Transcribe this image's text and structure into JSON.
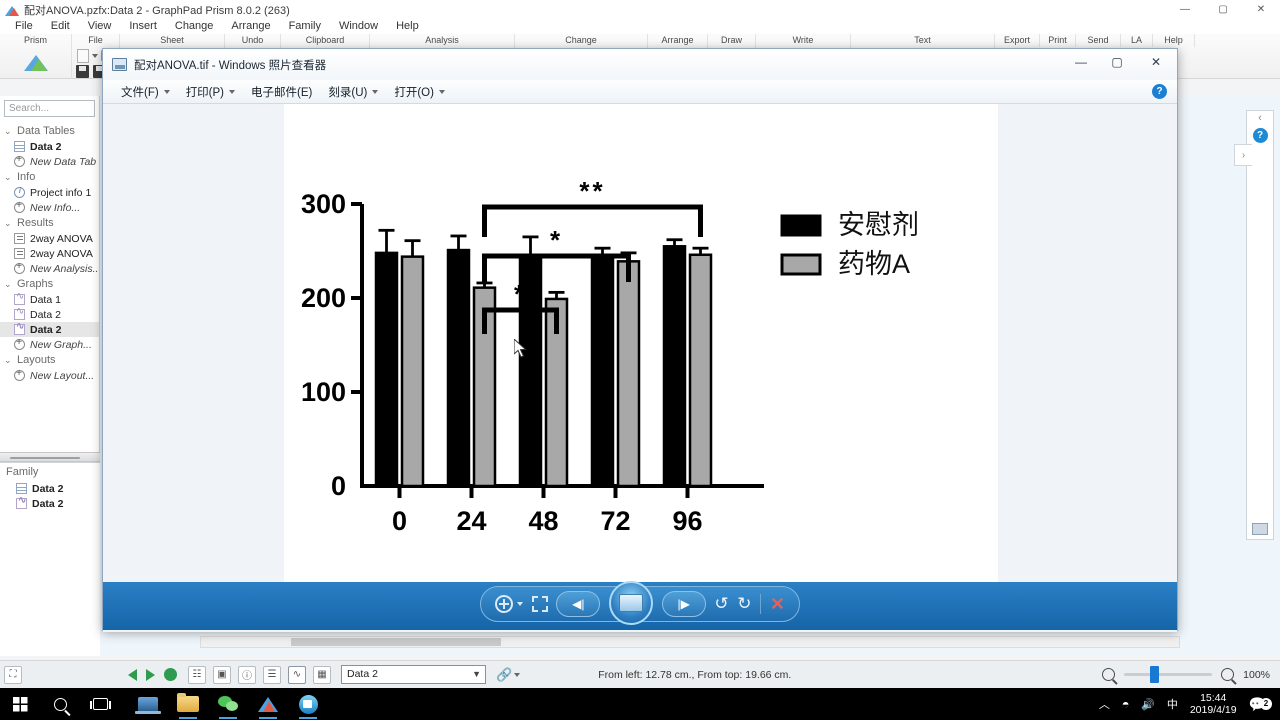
{
  "prism": {
    "title": "配对ANOVA.pzfx:Data 2 - GraphPad Prism 8.0.2 (263)",
    "window_buttons": {
      "minimize": "—",
      "maximize": "▢",
      "close": "✕"
    },
    "menus": [
      "File",
      "Edit",
      "View",
      "Insert",
      "Change",
      "Arrange",
      "Family",
      "Window",
      "Help"
    ],
    "ribbon_groups": [
      "Prism",
      "File",
      "Sheet",
      "Undo",
      "Clipboard",
      "Analysis",
      "Change",
      "Arrange",
      "Draw",
      "Write",
      "Text",
      "Export",
      "Print",
      "Send",
      "LA",
      "Help"
    ],
    "navigator": {
      "search_placeholder": "Search...",
      "sections": [
        {
          "title": "Data Tables",
          "items": [
            {
              "label": "Data 2",
              "icon": "table-icon",
              "style": "bold",
              "selected": false
            },
            {
              "label": "New Data Tab",
              "icon": "plus-icon",
              "style": "italic",
              "selected": false
            }
          ]
        },
        {
          "title": "Info",
          "items": [
            {
              "label": "Project info 1",
              "icon": "info-icon",
              "style": "normal",
              "selected": false
            },
            {
              "label": "New Info...",
              "icon": "plus-icon",
              "style": "italic",
              "selected": false
            }
          ]
        },
        {
          "title": "Results",
          "items": [
            {
              "label": "2way ANOVA",
              "icon": "results-icon",
              "style": "normal",
              "selected": false
            },
            {
              "label": "2way ANOVA",
              "icon": "results-icon",
              "style": "normal",
              "selected": false
            },
            {
              "label": "New Analysis...",
              "icon": "plus-icon",
              "style": "italic",
              "selected": false
            }
          ]
        },
        {
          "title": "Graphs",
          "items": [
            {
              "label": "Data 1",
              "icon": "graph-icon",
              "style": "normal",
              "selected": false
            },
            {
              "label": "Data 2",
              "icon": "graph-icon",
              "style": "normal",
              "selected": false
            },
            {
              "label": "Data 2",
              "icon": "graph-icon",
              "style": "bold",
              "selected": true
            },
            {
              "label": "New Graph...",
              "icon": "plus-icon",
              "style": "italic",
              "selected": false
            }
          ]
        },
        {
          "title": "Layouts",
          "items": [
            {
              "label": "New Layout...",
              "icon": "plus-icon",
              "style": "italic",
              "selected": false
            }
          ]
        }
      ]
    },
    "family": {
      "title": "Family",
      "items": [
        {
          "label": "Data 2",
          "icon": "table-icon"
        },
        {
          "label": "Data 2",
          "icon": "graph-icon"
        }
      ]
    },
    "status_bar": {
      "sheet_select_value": "Data 2",
      "coords": "From left: 12.78 cm., From top: 19.66 cm.",
      "zoom_level": "100%"
    }
  },
  "photo_viewer": {
    "title": "配对ANOVA.tif - Windows 照片查看器",
    "window_buttons": {
      "minimize": "—",
      "maximize": "▢",
      "close": "✕"
    },
    "menus": [
      {
        "label": "文件(F)",
        "has_caret": true
      },
      {
        "label": "打印(P)",
        "has_caret": true
      },
      {
        "label": "电子邮件(E)",
        "has_caret": false
      },
      {
        "label": "刻录(U)",
        "has_caret": true
      },
      {
        "label": "打开(O)",
        "has_caret": true
      }
    ],
    "help_button": "?",
    "toolbar": {
      "zoom_label": "zoom-icon",
      "fit_label": "fit-to-window-icon",
      "previous_label": "◀|",
      "play_label": "slideshow-icon",
      "next_label": "|▶",
      "rotate_left": "↺",
      "rotate_right": "↻",
      "delete": "✕"
    }
  },
  "chart_data": {
    "type": "bar",
    "title": "",
    "xlabel": "",
    "ylabel": "",
    "categories": [
      "0",
      "24",
      "48",
      "72",
      "96"
    ],
    "ytick_labels": [
      "0",
      "100",
      "200",
      "300"
    ],
    "yticks": [
      0,
      100,
      200,
      300
    ],
    "ylim": [
      0,
      300
    ],
    "grid": false,
    "legend_position": "right",
    "series": [
      {
        "name": "安慰剂",
        "color": "#000000",
        "values": [
          248,
          251,
          245,
          244,
          255
        ],
        "errors": [
          24,
          15,
          20,
          9,
          7
        ]
      },
      {
        "name": "药物A",
        "color": "#a8a8a8",
        "values": [
          244,
          211,
          199,
          239,
          246
        ],
        "errors": [
          17,
          5,
          7,
          9,
          7
        ]
      }
    ],
    "annotations": [
      {
        "label": "*",
        "from_group": "24",
        "from_series": "药物A",
        "to_group": "48",
        "to_series": "药物A"
      },
      {
        "label": "*",
        "from_group": "24",
        "from_series": "药物A",
        "to_group": "72",
        "to_series": "药物A"
      },
      {
        "label": "**",
        "from_group": "24",
        "from_series": "药物A",
        "to_group": "96",
        "to_series": "药物A"
      }
    ]
  },
  "taskbar": {
    "start_label": "start-icon",
    "search_label": "search-icon",
    "taskview_label": "task-view-icon",
    "apps": [
      "remote-desktop-icon",
      "file-explorer-icon",
      "wechat-icon",
      "graphpad-prism-icon",
      "camera-icon"
    ],
    "tray": {
      "expand": "︿",
      "network": "wifi-icon",
      "volume": "volume-icon",
      "ime": "中"
    },
    "clock_time": "15:44",
    "clock_date": "2019/4/19",
    "notification_count": "2"
  }
}
